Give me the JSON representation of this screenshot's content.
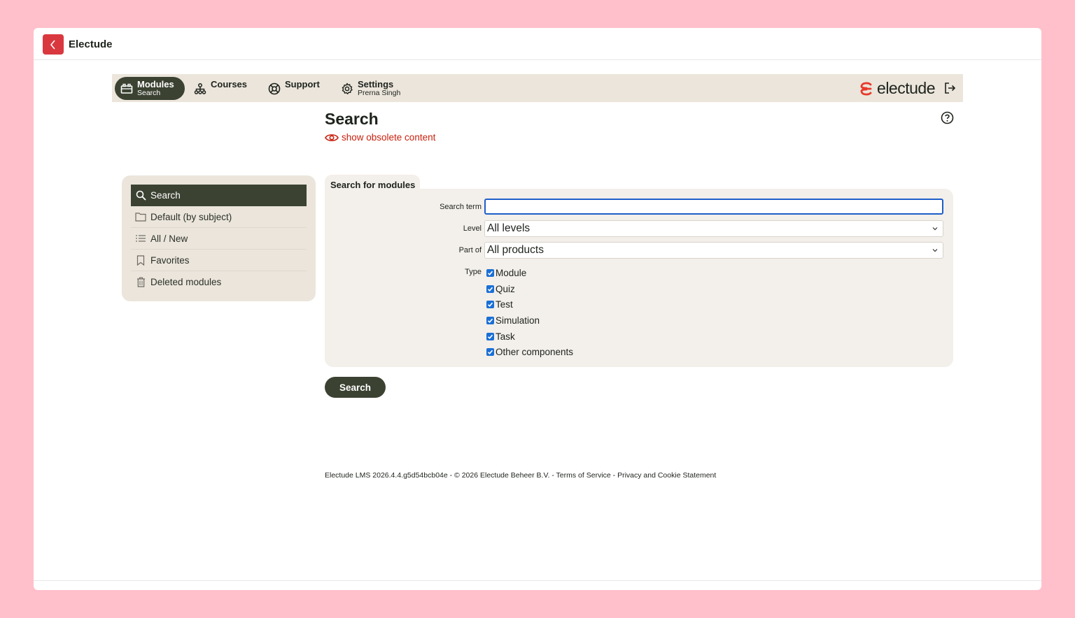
{
  "window": {
    "title": "Electude"
  },
  "nav": {
    "items": [
      {
        "label": "Modules",
        "sub": "Search",
        "icon": "modules-icon"
      },
      {
        "label": "Courses",
        "icon": "hierarchy-icon"
      },
      {
        "label": "Support",
        "icon": "lifebuoy-icon"
      },
      {
        "label": "Settings",
        "sub": "Prerna Singh",
        "icon": "gear-icon"
      }
    ],
    "brand": "electude"
  },
  "page": {
    "title": "Search",
    "obsolete_link": "show obsolete content"
  },
  "sidebar": {
    "items": [
      {
        "label": "Search",
        "icon": "search-icon",
        "active": true
      },
      {
        "label": "Default (by subject)",
        "icon": "folder-icon"
      },
      {
        "label": "All / New",
        "icon": "list-icon"
      },
      {
        "label": "Favorites",
        "icon": "bookmark-icon"
      },
      {
        "label": "Deleted modules",
        "icon": "trash-icon"
      }
    ]
  },
  "form": {
    "tab_title": "Search for modules",
    "search_label": "Search term",
    "search_value": "",
    "level_label": "Level",
    "level_value": "All levels",
    "partof_label": "Part of",
    "partof_value": "All products",
    "type_label": "Type",
    "types": [
      {
        "label": "Module",
        "checked": true
      },
      {
        "label": "Quiz",
        "checked": true
      },
      {
        "label": "Test",
        "checked": true
      },
      {
        "label": "Simulation",
        "checked": true
      },
      {
        "label": "Task",
        "checked": true
      },
      {
        "label": "Other components",
        "checked": true
      }
    ],
    "submit_label": "Search"
  },
  "footer": {
    "text": "Electude LMS 2026.4.4.g5d54bcb04e - © 2026 Electude Beheer B.V. - Terms of Service - Privacy and Cookie Statement"
  },
  "colors": {
    "accent_dark": "#3b4232",
    "nav_bg": "#ebe5dc",
    "link_red": "#c9200e",
    "brand_red": "#e8392a",
    "checkbox_blue": "#1a6fd6"
  }
}
